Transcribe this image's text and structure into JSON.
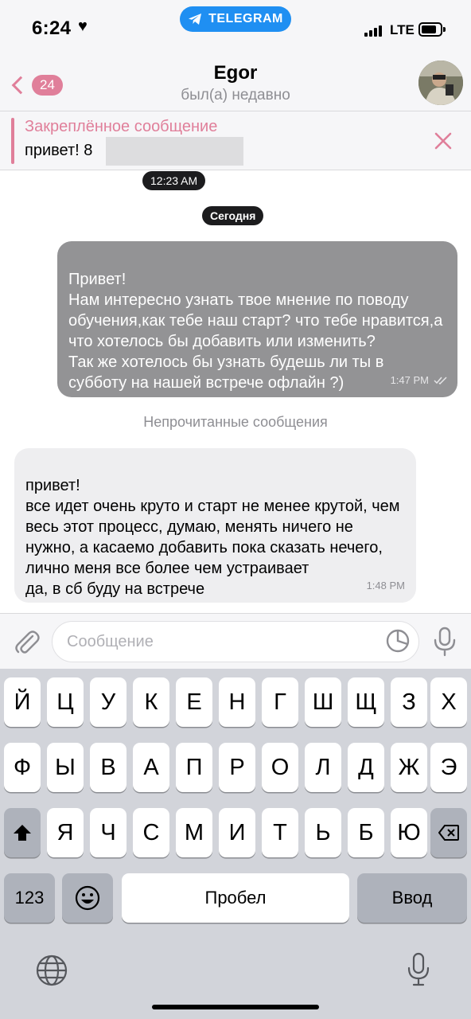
{
  "status_bar": {
    "time": "6:24",
    "heart": "♥",
    "telegram_pill": "TELEGRAM",
    "network": "LTE"
  },
  "header": {
    "back_count": "24",
    "contact_name": "Egor",
    "contact_status": "был(а) недавно"
  },
  "pinned": {
    "title": "Закреплённое сообщение",
    "text": "привет! 8"
  },
  "chat": {
    "date_pills": [
      "12:23 AM",
      "Сегодня"
    ],
    "outgoing": {
      "text": "Привет!\nНам интересно узнать твое мнение по поводу обучения,как тебе наш старт? что тебе нравится,а что хотелось бы добавить или изменить?\nТак же хотелось бы узнать будешь ли ты в субботу на нашей встрече офлайн ?)",
      "time": "1:47 PM"
    },
    "unread_label": "Непрочитанные сообщения",
    "incoming": {
      "text": "привет!\nвсе идет очень круто и старт не менее крутой, чем весь этот процесс, думаю, менять ничего не нужно, а касаемо добавить пока сказать нечего, лично меня все более чем устраивает\nда, в сб буду на встрече",
      "time": "1:48 PM"
    }
  },
  "input": {
    "placeholder": "Сообщение"
  },
  "keyboard": {
    "row1": [
      "Й",
      "Ц",
      "У",
      "К",
      "Е",
      "Н",
      "Г",
      "Ш",
      "Щ",
      "З",
      "Х"
    ],
    "row2": [
      "Ф",
      "Ы",
      "В",
      "А",
      "П",
      "Р",
      "О",
      "Л",
      "Д",
      "Ж",
      "Э"
    ],
    "row3": [
      "Я",
      "Ч",
      "С",
      "М",
      "И",
      "Т",
      "Ь",
      "Б",
      "Ю"
    ],
    "numbers_key": "123",
    "space_key": "Пробел",
    "return_key": "Ввод"
  },
  "colors": {
    "accent": "#e07f9a",
    "telegram_blue": "#1f8ff2",
    "outgoing_bubble": "#939395",
    "incoming_bubble": "#eeeef0"
  }
}
